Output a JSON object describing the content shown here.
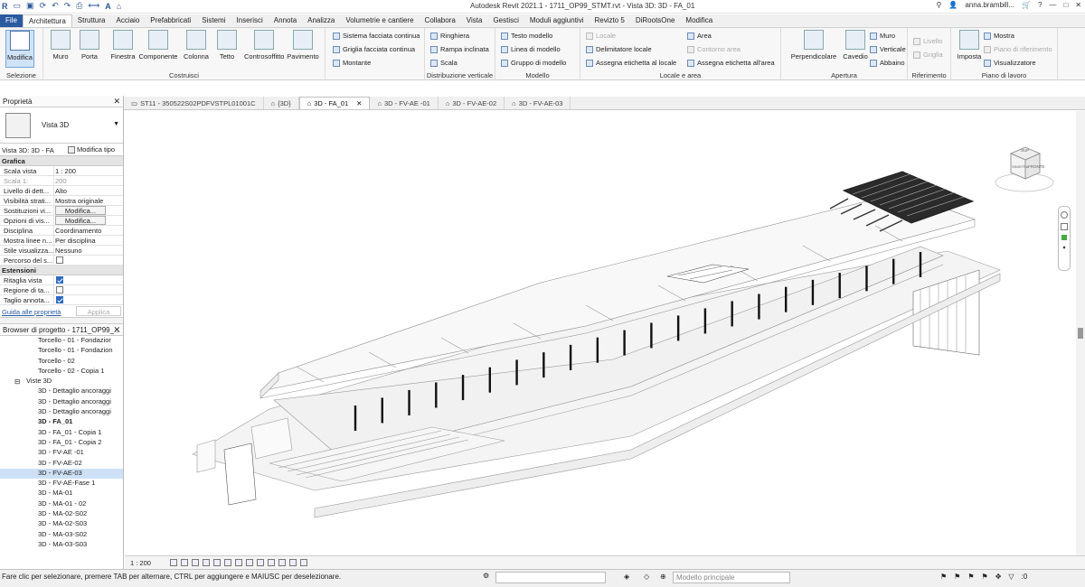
{
  "titlebar": {
    "title": "Autodesk Revit 2021.1 - 1711_OP99_STMT.rvt - Vista 3D: 3D - FA_01",
    "user": "anna.brambill..."
  },
  "tabs": [
    "File",
    "Architettura",
    "Struttura",
    "Acciaio",
    "Prefabbricati",
    "Sistemi",
    "Inserisci",
    "Annota",
    "Analizza",
    "Volumetrie e cantiere",
    "Collabora",
    "Vista",
    "Gestisci",
    "Moduli aggiuntivi",
    "Revizto 5",
    "DiRootsOne",
    "Modifica"
  ],
  "ribbon": {
    "select": {
      "modify": "Modifica",
      "label": "Selezione"
    },
    "build": {
      "items": [
        "Muro",
        "Porta",
        "Finestra",
        "Componente",
        "Colonna",
        "Tetto",
        "Controsoffitto",
        "Pavimento"
      ],
      "curtain": [
        "Sistema facciata continua",
        "Griglia facciata continua",
        "Montante"
      ],
      "label": "Costruisci"
    },
    "circulation": {
      "items": [
        "Ringhiera",
        "Rampa inclinata",
        "Scala"
      ],
      "label": "Distribuzione verticale"
    },
    "model": {
      "items": [
        "Testo modello",
        "Linea di modello",
        "Gruppo di modello"
      ],
      "label": "Modello"
    },
    "room": {
      "col1": [
        "Locale",
        "Delimitatore  locale",
        "Assegna etichetta  al locale"
      ],
      "col2": [
        "Area",
        "Contorno  area",
        "Assegna etichetta  all'area"
      ],
      "label": "Locale e area"
    },
    "opening": {
      "items": [
        "Perpendicolare",
        "Cavedio"
      ],
      "small": [
        "Muro",
        "Verticale",
        "Abbaino"
      ],
      "label": "Apertura"
    },
    "datum": {
      "items": [
        "Livello",
        "Griglia"
      ],
      "label": "Riferimento"
    },
    "workplane": {
      "set": "Imposta",
      "items": [
        "Mostra",
        "Piano di riferimento",
        "Visualizzatore"
      ],
      "label": "Piano di lavoro"
    }
  },
  "properties": {
    "title": "Proprietà",
    "type_name": "Vista 3D",
    "instance": "Vista 3D: 3D - FA",
    "edit_type": "Modifica tipo",
    "sections": [
      {
        "name": "Grafica",
        "rows": [
          {
            "k": "Scala vista",
            "v": "1 : 200",
            "kind": "text"
          },
          {
            "k": "Scala  1:",
            "v": "200",
            "kind": "dim"
          },
          {
            "k": "Livello di dett...",
            "v": "Alto",
            "kind": "text"
          },
          {
            "k": "Visibilità strati...",
            "v": "Mostra originale",
            "kind": "text"
          },
          {
            "k": "Sostituzioni vi...",
            "v": "Modifica...",
            "kind": "button"
          },
          {
            "k": "Opzioni di vis...",
            "v": "Modifica...",
            "kind": "button"
          },
          {
            "k": "Disciplina",
            "v": "Coordinamento",
            "kind": "text"
          },
          {
            "k": "Mostra linee n...",
            "v": "Per disciplina",
            "kind": "text"
          },
          {
            "k": "Stile visualizza...",
            "v": "Nessuno",
            "kind": "text"
          },
          {
            "k": "Percorso del s...",
            "v": "false",
            "kind": "check"
          }
        ]
      },
      {
        "name": "Estensioni",
        "rows": [
          {
            "k": "Ritaglia vista",
            "v": "true",
            "kind": "check"
          },
          {
            "k": "Regione di ta...",
            "v": "false",
            "kind": "check"
          },
          {
            "k": "Taglio annota...",
            "v": "true",
            "kind": "check"
          }
        ]
      }
    ],
    "help_link": "Guida alle proprietà",
    "apply": "Applica"
  },
  "browser": {
    "title": "Browser di progetto - 1711_OP99_...",
    "items": [
      {
        "t": "Torcello - 01 - Fondazior",
        "lvl": 2
      },
      {
        "t": "Torcello - 01 - Fondazion",
        "lvl": 2
      },
      {
        "t": "Torcello - 02",
        "lvl": 2
      },
      {
        "t": "Torcello - 02 - Copia 1",
        "lvl": 2
      },
      {
        "t": "Viste 3D",
        "lvl": 1,
        "node": "⊟"
      },
      {
        "t": "3D - Dettaglio ancoraggi",
        "lvl": 2
      },
      {
        "t": "3D - Dettaglio ancoraggi",
        "lvl": 2
      },
      {
        "t": "3D - Dettaglio ancoraggi",
        "lvl": 2
      },
      {
        "t": "3D - FA_01",
        "lvl": 2,
        "bold": true
      },
      {
        "t": "3D - FA_01 - Copia 1",
        "lvl": 2
      },
      {
        "t": "3D - FA_01 - Copia 2",
        "lvl": 2
      },
      {
        "t": "3D - FV-AE -01",
        "lvl": 2
      },
      {
        "t": "3D - FV-AE-02",
        "lvl": 2
      },
      {
        "t": "3D - FV-AE-03",
        "lvl": 2,
        "sel": true
      },
      {
        "t": "3D - FV-AE-Fase 1",
        "lvl": 2
      },
      {
        "t": "3D - MA-01",
        "lvl": 2
      },
      {
        "t": "3D - MA-01 - 02",
        "lvl": 2
      },
      {
        "t": "3D - MA-02-S02",
        "lvl": 2
      },
      {
        "t": "3D - MA-02-S03",
        "lvl": 2
      },
      {
        "t": "3D - MA-03-S02",
        "lvl": 2
      },
      {
        "t": "3D - MA-03-S03",
        "lvl": 2
      }
    ]
  },
  "view_tabs": [
    "ST11 - 350522S02PDFVSTPL01001C",
    "{3D}",
    "3D - FA_01",
    "3D - FV-AE -01",
    "3D - FV-AE-02",
    "3D - FV-AE-03"
  ],
  "active_view_tab": "3D - FA_01",
  "viewcube": {
    "top": "SUP",
    "left": "SINISTRA",
    "right": "FRONTE"
  },
  "viewbar": {
    "scale": "1 : 200"
  },
  "status": {
    "message": "Fare clic per selezionare, premere TAB per alternare, CTRL per aggiungere e MAIUSC per deselezionare.",
    "workset": "",
    "model": "Modello principale",
    "filter": ":0"
  },
  "colors": {
    "accent": "#2a5aa0",
    "selection": "#cde0f5"
  }
}
